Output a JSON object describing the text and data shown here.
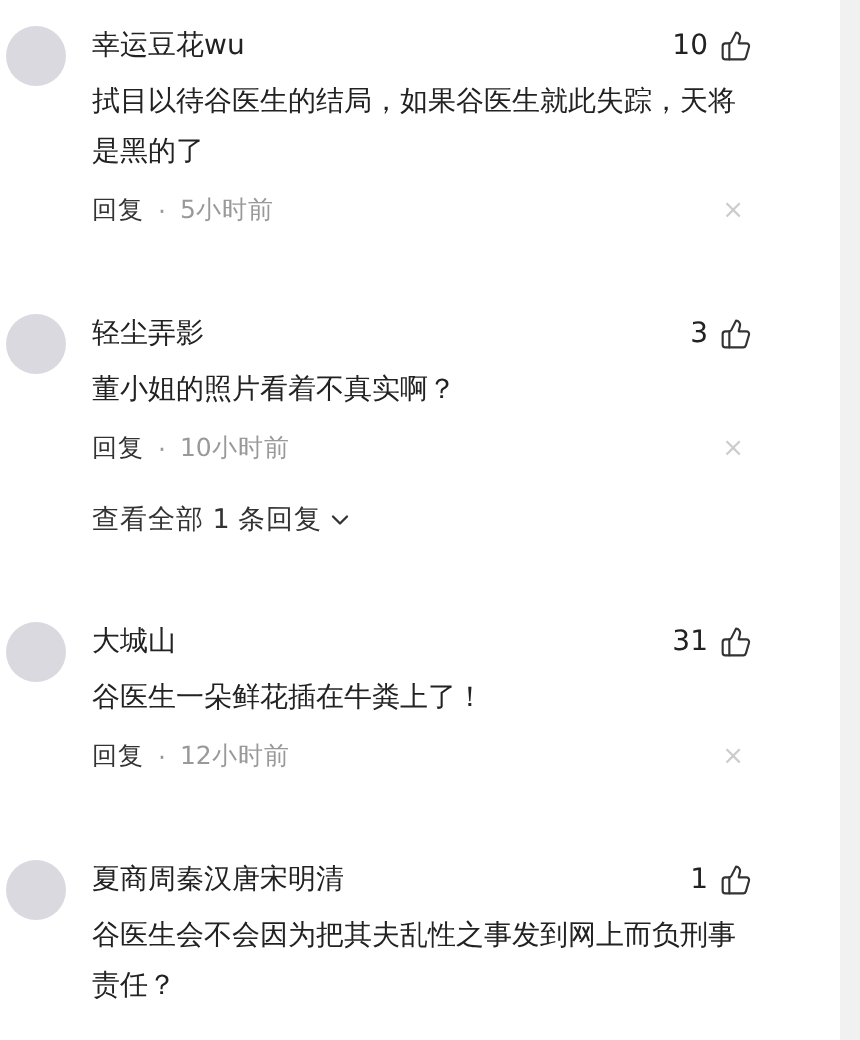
{
  "comments": [
    {
      "name": "幸运豆花wu",
      "likes": "10",
      "text": "拭目以待谷医生的结局，如果谷医生就此失踪，天将是黑的了",
      "reply": "回复",
      "separator": "·",
      "time": "5小时前",
      "dismiss": "×"
    },
    {
      "name": "轻尘弄影",
      "likes": "3",
      "text": "董小姐的照片看着不真实啊？",
      "reply": "回复",
      "separator": "·",
      "time": "10小时前",
      "dismiss": "×",
      "view_replies": "查看全部 1 条回复"
    },
    {
      "name": "大城山",
      "likes": "31",
      "text": "谷医生一朵鲜花插在牛粪上了！",
      "reply": "回复",
      "separator": "·",
      "time": "12小时前",
      "dismiss": "×"
    },
    {
      "name": "夏商周秦汉唐宋明清",
      "likes": "1",
      "text": "谷医生会不会因为把其夫乱性之事发到网上而负刑事责任？"
    }
  ]
}
